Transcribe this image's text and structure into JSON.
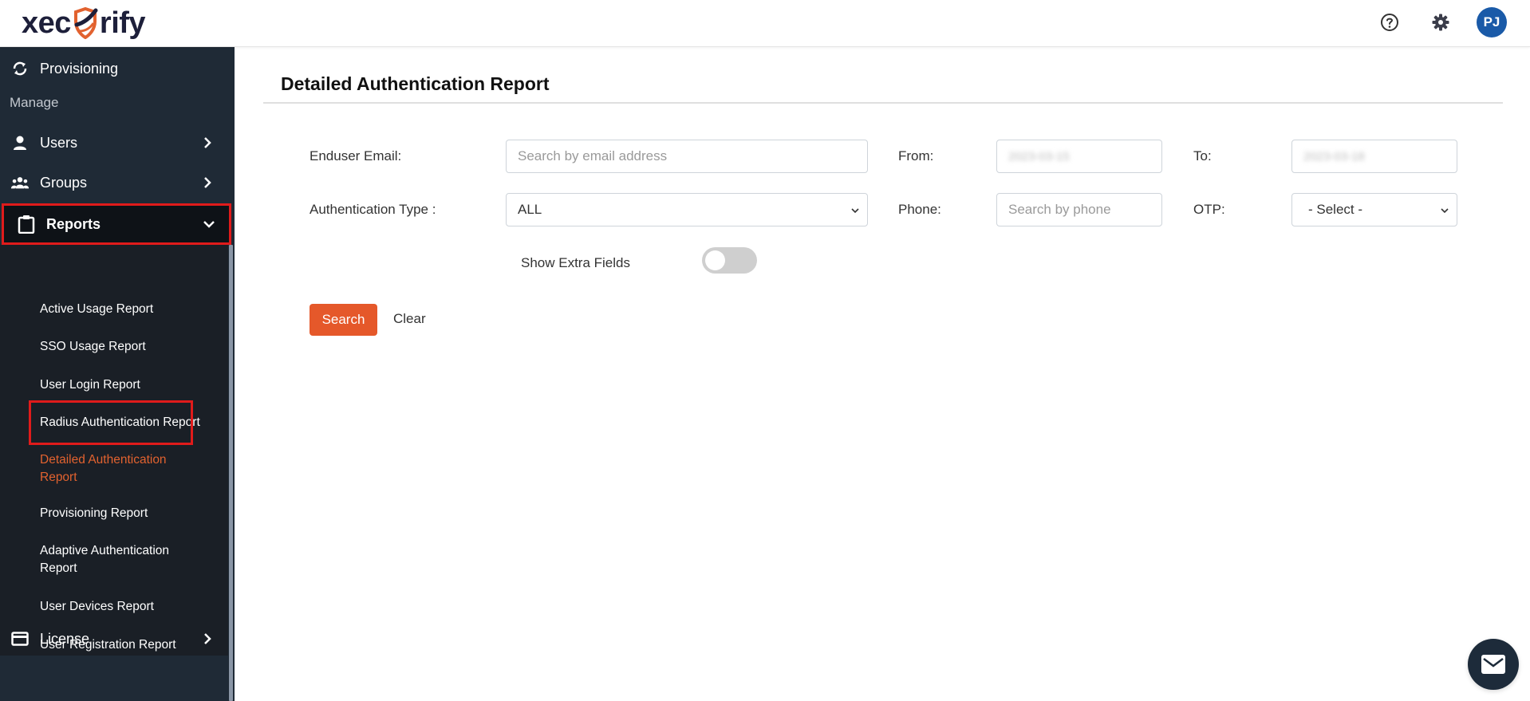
{
  "header": {
    "logo_text_left": "xec",
    "logo_text_right": "rify",
    "avatar_initials": "PJ",
    "icons": [
      "help-icon",
      "gear-icon"
    ]
  },
  "sidebar": {
    "provisioning": {
      "label": "Provisioning",
      "icon": "sync-icon"
    },
    "section_label": "Manage",
    "items": [
      {
        "label": "Users",
        "icon": "user-icon",
        "expanded": false
      },
      {
        "label": "Groups",
        "icon": "groups-icon",
        "expanded": false
      },
      {
        "label": "Reports",
        "icon": "clipboard-icon",
        "expanded": true
      }
    ],
    "reports_submenu": [
      {
        "label": "Active Usage Report",
        "active": false
      },
      {
        "label": "SSO Usage Report",
        "active": false
      },
      {
        "label": "User Login Report",
        "active": false
      },
      {
        "label": "Radius Authentication Report",
        "active": false
      },
      {
        "label": "Detailed Authentication Report",
        "active": true
      },
      {
        "label": "Provisioning Report",
        "active": false
      },
      {
        "label": "Adaptive Authentication Report",
        "active": false
      },
      {
        "label": "User Devices Report",
        "active": false
      },
      {
        "label": "User Registration Report",
        "active": false
      }
    ],
    "license": {
      "label": "License",
      "icon": "credit-card-icon"
    }
  },
  "main": {
    "title": "Detailed Authentication Report",
    "form": {
      "email_label": "Enduser Email:",
      "email_placeholder": "Search by email address",
      "email_value": "",
      "from_label": "From:",
      "from_value": "2023-03-15",
      "to_label": "To:",
      "to_value": "2023-03-18",
      "auth_type_label": "Authentication Type :",
      "auth_type_value": "ALL",
      "phone_label": "Phone:",
      "phone_placeholder": "Search by phone",
      "phone_value": "",
      "otp_label": "OTP:",
      "otp_value": "- Select -",
      "extra_fields_label": "Show Extra Fields",
      "extra_fields_on": false
    },
    "search_label": "Search",
    "clear_label": "Clear"
  },
  "colors": {
    "accent": "#e5582a",
    "sidebar_bg": "#1f2a36",
    "highlight_border": "#e01b1b",
    "avatar_bg": "#1a5aa8"
  }
}
